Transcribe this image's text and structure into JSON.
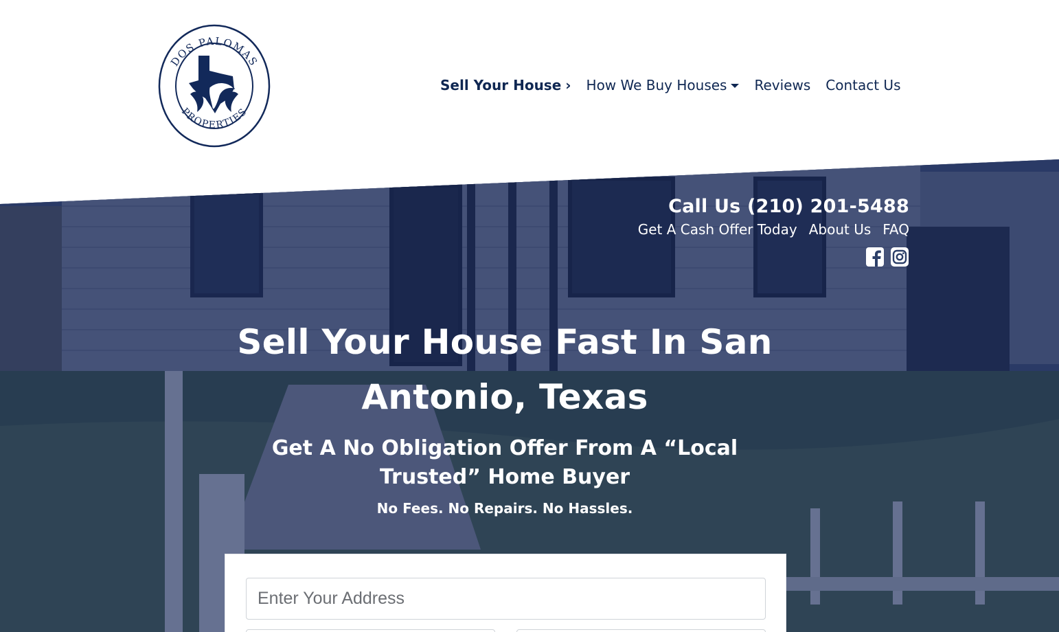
{
  "brand": {
    "logo_icon": "dos-palomas-logo",
    "logo_text_top": "DOS PALOMAS",
    "logo_text_bottom": "PROPERTIES",
    "color_primary": "#0f2752"
  },
  "nav": {
    "items": [
      {
        "label": "Sell Your House",
        "active": true
      },
      {
        "label": "How We Buy Houses"
      },
      {
        "label": "Reviews"
      },
      {
        "label": "Contact Us"
      }
    ]
  },
  "hero": {
    "call": "Call Us (210) 201-5488",
    "sublinks": [
      "Get A Cash Offer Today",
      "About Us",
      "FAQ"
    ],
    "social": [
      "facebook-icon",
      "instagram-icon"
    ],
    "headline_line1": "Sell Your House Fast In San",
    "headline_line2": "Antonio, Texas",
    "subheadline_line1": "Get A No Obligation Offer From A “Local",
    "subheadline_line2": "Trusted” Home Buyer",
    "tagline": "No Fees. No Repairs. No Hassles.",
    "overlay_color": "#152554"
  },
  "form": {
    "address_placeholder": "Enter Your Address",
    "address_value": ""
  }
}
